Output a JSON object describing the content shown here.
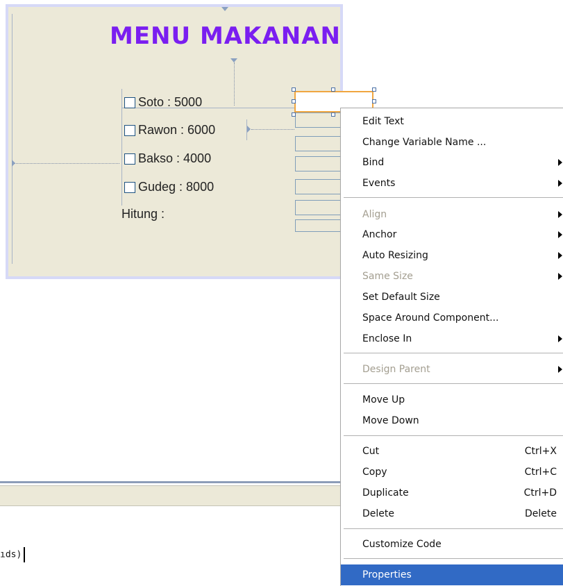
{
  "form": {
    "title": "MENU MAKANAN",
    "title_color": "#7a1ef0",
    "canvas_bg": "#ece9d8",
    "items": [
      {
        "label": "Soto : 5000",
        "checked": false
      },
      {
        "label": "Rawon : 6000",
        "checked": false
      },
      {
        "label": "Bakso : 4000",
        "checked": false
      },
      {
        "label": "Gudeg : 8000",
        "checked": false
      }
    ],
    "hitung_label": "Hitung :"
  },
  "editor": {
    "code_fragment": "ıds)"
  },
  "context_menu": {
    "selected_bg": "#316ac5",
    "items": [
      {
        "label": "Edit Text"
      },
      {
        "label": "Change Variable Name ..."
      },
      {
        "label": "Bind",
        "submenu": true
      },
      {
        "label": "Events",
        "submenu": true
      },
      {
        "label": "Align",
        "submenu": true,
        "disabled": true
      },
      {
        "label": "Anchor",
        "submenu": true
      },
      {
        "label": "Auto Resizing",
        "submenu": true
      },
      {
        "label": "Same Size",
        "submenu": true,
        "disabled": true
      },
      {
        "label": "Set Default Size"
      },
      {
        "label": "Space Around Component..."
      },
      {
        "label": "Enclose In",
        "submenu": true
      },
      {
        "label": "Design Parent",
        "submenu": true,
        "disabled": true
      },
      {
        "label": "Move Up"
      },
      {
        "label": "Move Down"
      },
      {
        "label": "Cut",
        "shortcut": "Ctrl+X"
      },
      {
        "label": "Copy",
        "shortcut": "Ctrl+C"
      },
      {
        "label": "Duplicate",
        "shortcut": "Ctrl+D"
      },
      {
        "label": "Delete",
        "shortcut": "Delete"
      },
      {
        "label": "Customize Code"
      },
      {
        "label": "Properties",
        "selected": true
      }
    ]
  }
}
